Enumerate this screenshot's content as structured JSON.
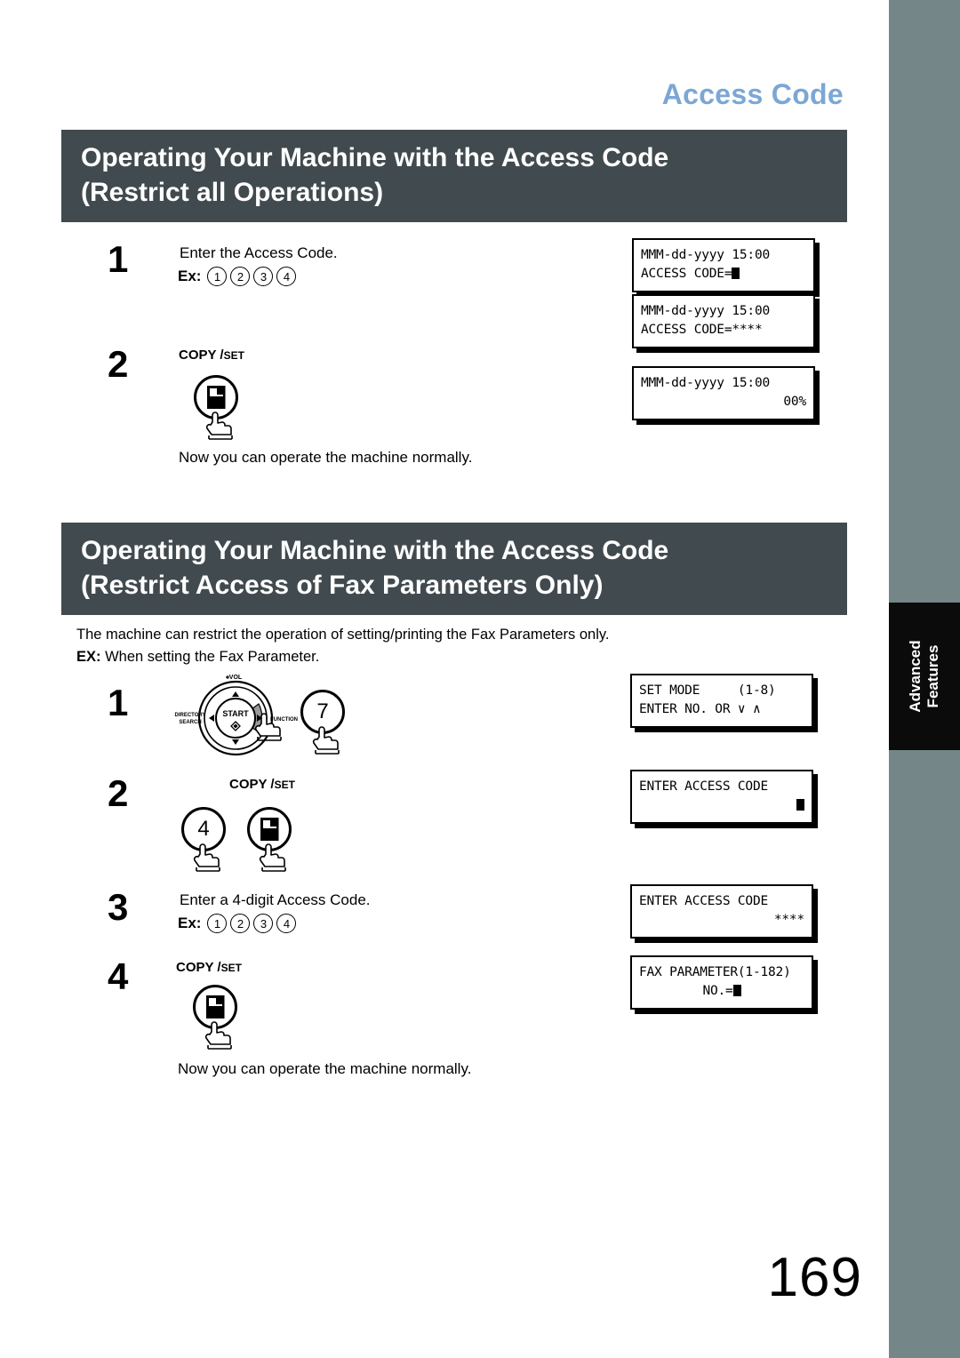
{
  "running_head": "Access Code",
  "sidebar_tab": {
    "line1": "Advanced",
    "line2": "Features"
  },
  "page_number": "169",
  "colors": {
    "accent_blue": "#7ba7d4",
    "banner_bg": "#414a4e",
    "strip": "#748688",
    "tab_bg": "#0b0b0b"
  },
  "section1": {
    "title_line1": "Operating Your Machine with the Access Code",
    "title_line2": "(Restrict all Operations)",
    "steps": [
      {
        "number": "1",
        "instruction": "Enter the Access Code.",
        "ex_label": "Ex:",
        "ex_digits": [
          "1",
          "2",
          "3",
          "4"
        ]
      },
      {
        "number": "2",
        "key_main": "COPY /",
        "key_sub": "SET",
        "key_icon": "copy-set-page-icon"
      }
    ],
    "closing_text": "Now you can operate the machine normally.",
    "displays": [
      {
        "line1": "MMM-dd-yyyy 15:00",
        "line2": "ACCESS CODE=",
        "cursor": true,
        "align2": "left"
      },
      {
        "line1": "MMM-dd-yyyy 15:00",
        "line2": "ACCESS CODE=****",
        "cursor": false,
        "align2": "left"
      },
      {
        "line1": "MMM-dd-yyyy 15:00",
        "line2": "00%",
        "cursor": false,
        "align2": "right"
      }
    ]
  },
  "section2": {
    "title_line1": "Operating Your Machine with the Access Code",
    "title_line2": "(Restrict Access of Fax Parameters Only)",
    "intro_line1": "The machine can restrict the operation of setting/printing the Fax Parameters only.",
    "intro_ex_label": "EX:",
    "intro_line2": "When setting the Fax Parameter.",
    "dial": {
      "center": "START",
      "top": "VOL",
      "left_line1": "DIRECTORY",
      "left_line2": "SEARCH",
      "right": "FUNCTION"
    },
    "steps": [
      {
        "number": "1",
        "key_digit": "7"
      },
      {
        "number": "2",
        "key_main": "COPY /",
        "key_sub": "SET",
        "key_digit": "4"
      },
      {
        "number": "3",
        "instruction": "Enter a 4-digit Access Code.",
        "ex_label": "Ex:",
        "ex_digits": [
          "1",
          "2",
          "3",
          "4"
        ]
      },
      {
        "number": "4",
        "key_main": "COPY /",
        "key_sub": "SET"
      }
    ],
    "closing_text": "Now you can operate the machine normally.",
    "displays": [
      {
        "line1": "SET MODE     (1-8)",
        "line2": "ENTER NO. OR ∨ ∧",
        "cursor": false,
        "align2": "left"
      },
      {
        "line1": "ENTER ACCESS CODE",
        "line2": "",
        "cursor": true,
        "align2": "right"
      },
      {
        "line1": "ENTER ACCESS CODE",
        "line2": "****",
        "cursor": false,
        "align2": "right"
      },
      {
        "line1": "FAX PARAMETER(1-182)",
        "line2": "NO.=",
        "cursor": true,
        "align2": "center"
      }
    ]
  }
}
